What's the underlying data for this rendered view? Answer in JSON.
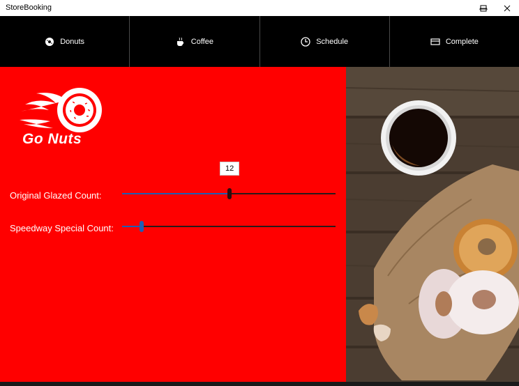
{
  "window": {
    "title": "StoreBooking"
  },
  "nav": {
    "items": [
      {
        "label": "Donuts",
        "icon": "donut-icon"
      },
      {
        "label": "Coffee",
        "icon": "coffee-icon"
      },
      {
        "label": "Schedule",
        "icon": "clock-icon"
      },
      {
        "label": "Complete",
        "icon": "card-icon"
      }
    ]
  },
  "brand": {
    "logo_text": "Go Nuts"
  },
  "sliders": [
    {
      "label": "Original Glazed Count:",
      "value": 12,
      "tooltip": "12",
      "thumb_color": "#2a0d0d"
    },
    {
      "label": "Speedway Special Count:",
      "value": 2,
      "thumb_color": "#1e5fb5"
    }
  ],
  "colors": {
    "accent": "#ff0000",
    "nav_bg": "#000000",
    "slider_fill": "#1e5fb5"
  }
}
